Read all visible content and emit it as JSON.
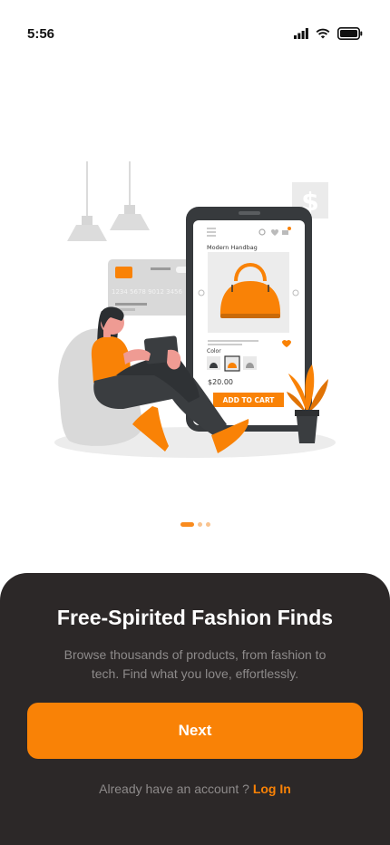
{
  "status_bar": {
    "time": "5:56"
  },
  "illustration": {
    "product_name": "Modern Handbag",
    "color_label": "Color",
    "price": "$20.00",
    "cart_button": "ADD TO CART",
    "card_number": "1234 5678 9012 3456",
    "currency_sign": "$"
  },
  "onboarding": {
    "page_count": 3,
    "active_page": 1,
    "title": "Free-Spirited Fashion Finds",
    "description": "Browse thousands of products, from fashion to tech. Find what you love, effortlessly.",
    "next_label": "Next",
    "account_prompt": "Already have an account ?",
    "login_label": "Log In"
  },
  "colors": {
    "accent": "#f98206",
    "sheet": "#2c2828",
    "muted_text": "#8d8a8a"
  }
}
